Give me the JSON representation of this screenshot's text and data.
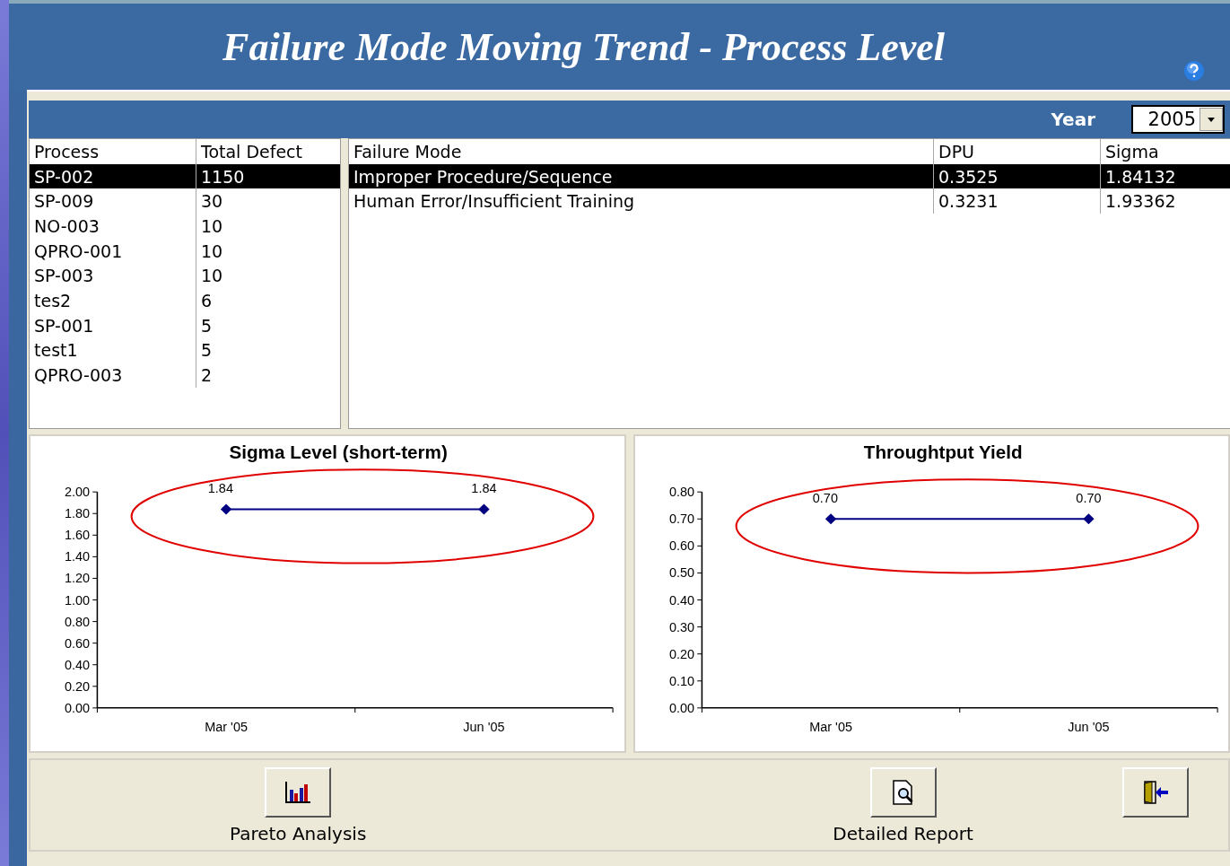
{
  "header": {
    "title": "Failure Mode Moving Trend - Process Level"
  },
  "filter": {
    "label": "Year",
    "value": "2005"
  },
  "process_table": {
    "columns": [
      "Process",
      "Total Defect"
    ],
    "rows": [
      {
        "cells": [
          "SP-002",
          "1150"
        ],
        "selected": true
      },
      {
        "cells": [
          "SP-009",
          "30"
        ],
        "selected": false
      },
      {
        "cells": [
          "NO-003",
          "10"
        ],
        "selected": false
      },
      {
        "cells": [
          "QPRO-001",
          "10"
        ],
        "selected": false
      },
      {
        "cells": [
          "SP-003",
          "10"
        ],
        "selected": false
      },
      {
        "cells": [
          "tes2",
          "6"
        ],
        "selected": false
      },
      {
        "cells": [
          "SP-001",
          "5"
        ],
        "selected": false
      },
      {
        "cells": [
          "test1",
          "5"
        ],
        "selected": false
      },
      {
        "cells": [
          "QPRO-003",
          "2"
        ],
        "selected": false
      }
    ]
  },
  "failure_table": {
    "columns": [
      "Failure Mode",
      "DPU",
      "Sigma"
    ],
    "rows": [
      {
        "cells": [
          "Improper Procedure/Sequence",
          "0.3525",
          "1.84132"
        ],
        "selected": true
      },
      {
        "cells": [
          "Human Error/Insufficient Training",
          "0.3231",
          "1.93362"
        ],
        "selected": false
      }
    ]
  },
  "charts": [
    {
      "chart_data": {
        "type": "line",
        "title": "Sigma Level (short-term)",
        "categories": [
          "Mar '05",
          "Jun '05"
        ],
        "series": [
          {
            "color": "#000080",
            "marker": "diamond",
            "values": [
              1.84,
              1.84
            ]
          }
        ],
        "ylim": [
          0,
          2
        ],
        "yticks": [
          {
            "value": 0,
            "label": "0.00"
          },
          {
            "value": 0.2,
            "label": "0.20"
          },
          {
            "value": 0.4,
            "label": "0.40"
          },
          {
            "value": 0.6,
            "label": "0.60"
          },
          {
            "value": 0.8,
            "label": "0.80"
          },
          {
            "value": 1,
            "label": "1.00"
          },
          {
            "value": 1.2,
            "label": "1.20"
          },
          {
            "value": 1.4,
            "label": "1.40"
          },
          {
            "value": 1.6,
            "label": "1.60"
          },
          {
            "value": 1.8,
            "label": "1.80"
          },
          {
            "value": 2,
            "label": "2.00"
          }
        ],
        "value_labels": [
          "1.84",
          "1.84"
        ]
      },
      "highlighted": true
    },
    {
      "chart_data": {
        "type": "line",
        "title": "Throughtput Yield",
        "categories": [
          "Mar '05",
          "Jun '05"
        ],
        "series": [
          {
            "color": "#000080",
            "marker": "diamond",
            "values": [
              0.7,
              0.7
            ]
          }
        ],
        "ylim": [
          0,
          0.8
        ],
        "yticks": [
          {
            "value": 0,
            "label": "0.00"
          },
          {
            "value": 0.1,
            "label": "0.10"
          },
          {
            "value": 0.2,
            "label": "0.20"
          },
          {
            "value": 0.3,
            "label": "0.30"
          },
          {
            "value": 0.4,
            "label": "0.40"
          },
          {
            "value": 0.5,
            "label": "0.50"
          },
          {
            "value": 0.6,
            "label": "0.60"
          },
          {
            "value": 0.7,
            "label": "0.70"
          },
          {
            "value": 0.8,
            "label": "0.80"
          }
        ],
        "value_labels": [
          "0.70",
          "0.70"
        ]
      },
      "highlighted": true
    }
  ],
  "buttons": [
    {
      "kind": "chart",
      "label": "Pareto Analysis"
    },
    {
      "kind": "report",
      "label": "Detailed Report"
    },
    {
      "kind": "exit"
    }
  ]
}
